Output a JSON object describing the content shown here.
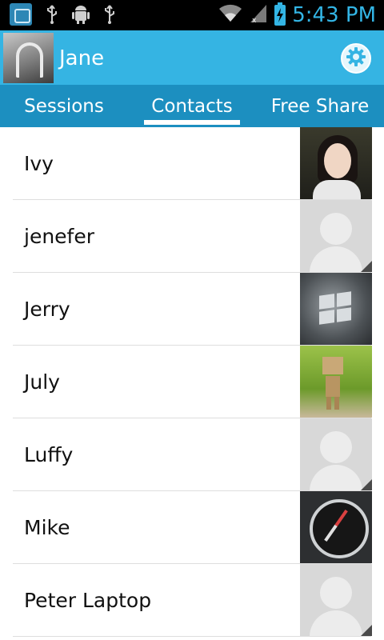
{
  "status_bar": {
    "time": "5:43 PM",
    "icons": [
      "app-notification-icon",
      "usb-icon",
      "android-debug-icon",
      "usb-icon",
      "wifi-icon",
      "signal-icon",
      "battery-charging-icon"
    ],
    "accent_color": "#33b5e5"
  },
  "profile": {
    "name": "Jane",
    "header_color": "#35b4e3",
    "settings_icon": "gear-icon"
  },
  "tabs": {
    "items": [
      {
        "label": "Sessions"
      },
      {
        "label": "Contacts"
      },
      {
        "label": "Free Share"
      }
    ],
    "selected": "Contacts",
    "bar_color": "#1c8fc0"
  },
  "contacts": [
    {
      "name": "Ivy",
      "photo": "photo-woman"
    },
    {
      "name": "jenefer",
      "photo": "default-avatar"
    },
    {
      "name": "Jerry",
      "photo": "photo-windows-logo"
    },
    {
      "name": "July",
      "photo": "photo-danbo-figure"
    },
    {
      "name": "Luffy",
      "photo": "default-avatar"
    },
    {
      "name": "Mike",
      "photo": "photo-compass"
    },
    {
      "name": "Peter Laptop",
      "photo": "default-avatar"
    }
  ]
}
